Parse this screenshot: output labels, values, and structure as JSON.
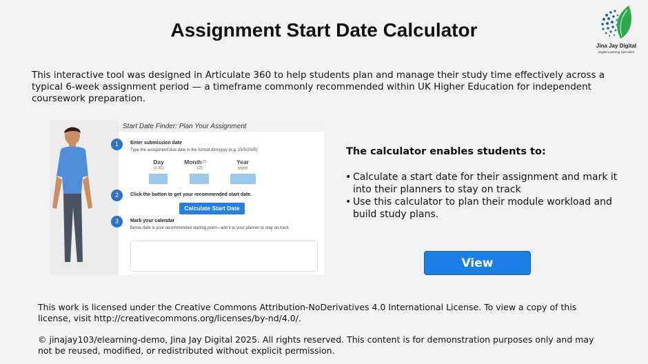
{
  "header": {
    "title": "Assignment Start Date Calculator"
  },
  "logo": {
    "brand": "Jina Jay Digital",
    "tagline": "Digital Learning Specialist",
    "colors": {
      "green": "#2fa84f",
      "blue": "#1f5fa3",
      "teal": "#1e9e9b"
    }
  },
  "intro": "This interactive tool was designed in Articulate 360 to help students plan and manage their study time effectively across a typical 6-week assignment period — a timeframe commonly recommended within UK Higher Education for independent coursework preparation.",
  "preview": {
    "title": "Start Date Finder: Plan Your Assignment",
    "steps": [
      {
        "number": "1",
        "title": "Enter submission date",
        "description": "Type the assignment due date in the format d/m/yyyy (e.g. 15/5/2025)"
      },
      {
        "number": "2",
        "title": "Click the button to get your recommended start date."
      },
      {
        "number": "3",
        "title": "Mark your calendar",
        "description": "Below date is your recommended starting point—add it to your planner to stay on track."
      }
    ],
    "fields": [
      {
        "label": "Day",
        "hint": "(1-31)"
      },
      {
        "label": "Month",
        "hint": "12)"
      },
      {
        "label": "Year",
        "hint": "(yyyy)"
      }
    ],
    "month_label_suffix": "(1-",
    "button_label": "Calculate Start Date"
  },
  "enables": {
    "heading": "The calculator enables students to:",
    "items": [
      "Calculate a start date for their assignment and mark it into their planners to stay on track",
      "Use this calculator to plan their module workload and build study plans."
    ]
  },
  "view_button": {
    "label": "View",
    "color": "#1b80e3"
  },
  "footer": {
    "license": "This work is licensed under the Creative Commons Attribution-NoDerivatives 4.0 International License. To view a copy of this license, visit http://creativecommons.org/licenses/by-nd/4.0/.",
    "copyright": "© jinajay103/elearning-demo, Jina Jay Digital 2025. All rights reserved. This content is for demonstration purposes only and may not be reused, modified, or redistributed without explicit permission."
  }
}
